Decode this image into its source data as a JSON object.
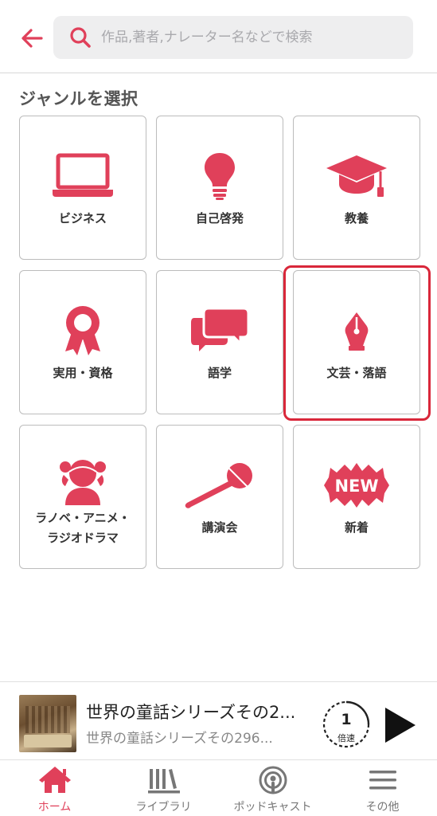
{
  "header": {
    "back_icon": "arrow-left-icon",
    "search": {
      "icon": "search-icon",
      "placeholder": "作品,著者,ナレーター名などで検索",
      "value": ""
    }
  },
  "section_title": "ジャンルを選択",
  "genres": [
    {
      "label": "ビジネス",
      "icon": "laptop-icon"
    },
    {
      "label": "自己啓発",
      "icon": "lightbulb-icon"
    },
    {
      "label": "教養",
      "icon": "graduation-cap-icon"
    },
    {
      "label": "実用・資格",
      "icon": "award-ribbon-icon"
    },
    {
      "label": "語学",
      "icon": "speech-bubbles-icon"
    },
    {
      "label": "文芸・落語",
      "icon": "fountain-pen-icon"
    },
    {
      "label_line1": "ラノベ・アニメ・",
      "label_line2": "ラジオドラマ",
      "icon": "girl-avatar-icon"
    },
    {
      "label": "講演会",
      "icon": "microphone-icon"
    },
    {
      "label": "新着",
      "icon": "new-badge-icon",
      "badge_text": "NEW"
    }
  ],
  "selected_genre": "文芸・落語",
  "player": {
    "title": "世界の童話シリーズその2...",
    "subtitle": "世界の童話シリーズその296...",
    "speed_value": "1",
    "speed_unit": "倍速",
    "play_icon": "play-icon"
  },
  "tabbar": [
    {
      "label": "ホーム",
      "icon": "home-icon",
      "active": true
    },
    {
      "label": "ライブラリ",
      "icon": "library-icon",
      "active": false
    },
    {
      "label": "ポッドキャスト",
      "icon": "podcast-icon",
      "active": false
    },
    {
      "label": "その他",
      "icon": "menu-icon",
      "active": false
    }
  ],
  "colors": {
    "accent": "#e0405a",
    "highlight": "#d9273a"
  }
}
